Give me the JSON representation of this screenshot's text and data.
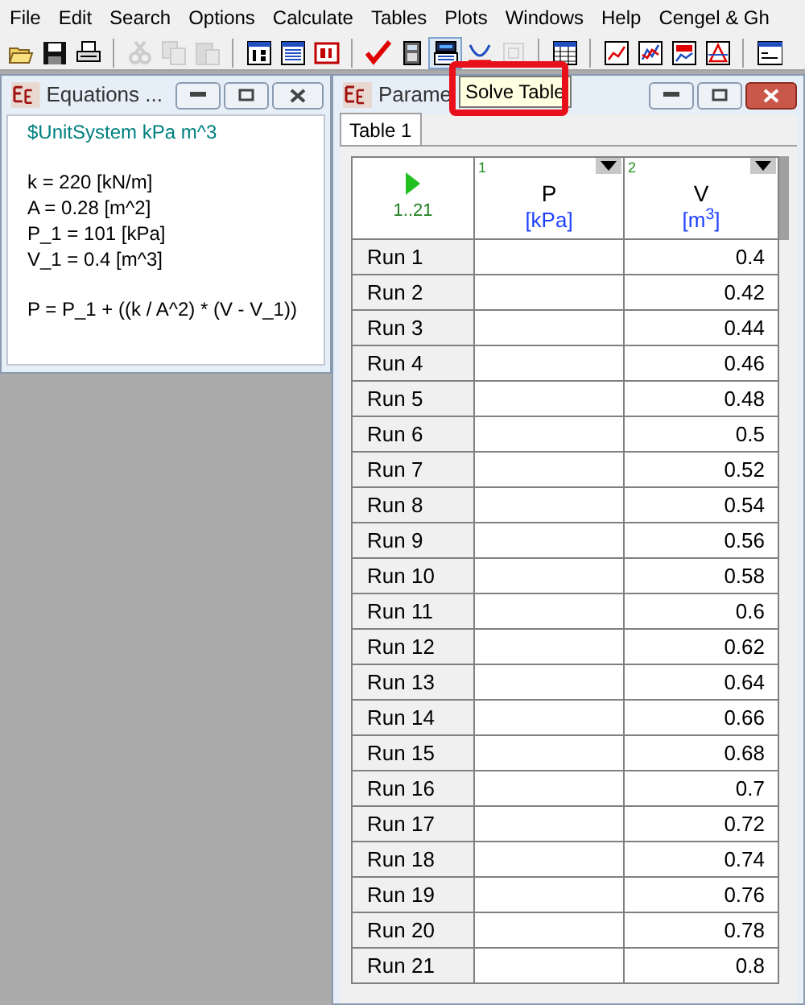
{
  "menu": [
    "File",
    "Edit",
    "Search",
    "Options",
    "Calculate",
    "Tables",
    "Plots",
    "Windows",
    "Help",
    "Cengel & Gh"
  ],
  "toolbar": [
    [
      {
        "kind": "open",
        "disabled": false
      },
      {
        "kind": "save",
        "disabled": false
      },
      {
        "kind": "print",
        "disabled": false
      }
    ],
    [
      {
        "kind": "cut",
        "disabled": true
      },
      {
        "kind": "copy",
        "disabled": true
      },
      {
        "kind": "paste",
        "disabled": true
      }
    ],
    [
      {
        "kind": "info",
        "disabled": false
      },
      {
        "kind": "list",
        "disabled": false
      },
      {
        "kind": "units",
        "disabled": false
      }
    ],
    [
      {
        "kind": "check",
        "disabled": false
      },
      {
        "kind": "calc",
        "disabled": false
      },
      {
        "kind": "solvetable",
        "disabled": false,
        "highlighted": true
      },
      {
        "kind": "curve",
        "disabled": false
      },
      {
        "kind": "gbox",
        "disabled": true
      }
    ],
    [
      {
        "kind": "table",
        "disabled": false
      }
    ],
    [
      {
        "kind": "plot1",
        "disabled": false
      },
      {
        "kind": "plot2",
        "disabled": false
      },
      {
        "kind": "plot3",
        "disabled": false
      },
      {
        "kind": "plot4",
        "disabled": false
      }
    ],
    [
      {
        "kind": "formula",
        "disabled": false
      }
    ]
  ],
  "tooltip": "Solve Table",
  "equations_window": {
    "title": "Equations ...",
    "blocks": [
      [
        {
          "kind": "directive",
          "text": "$UnitSystem kPa m^3"
        }
      ],
      [
        {
          "kind": "equation",
          "text": "k = 220 [kN/m]"
        },
        {
          "kind": "equation",
          "text": "A = 0.28 [m^2]"
        },
        {
          "kind": "equation",
          "text": "P_1 = 101 [kPa]"
        },
        {
          "kind": "equation",
          "text": "V_1 = 0.4 [m^3]"
        }
      ],
      [
        {
          "kind": "equation",
          "text": "P = P_1 + ((k / A^2) * (V - V_1))"
        }
      ]
    ]
  },
  "parametric_window": {
    "title": "Parame",
    "tabs": [
      {
        "label": "Table 1",
        "selected": true
      }
    ],
    "run_range": "1..21",
    "columns": [
      {
        "number": "1",
        "name": "P",
        "unit": "[kPa]"
      },
      {
        "number": "2",
        "name": "V",
        "unit": "[m$^{3}$]"
      }
    ],
    "rows": [
      {
        "label": "Run 1",
        "P": "",
        "V": "0.4"
      },
      {
        "label": "Run 2",
        "P": "",
        "V": "0.42"
      },
      {
        "label": "Run 3",
        "P": "",
        "V": "0.44"
      },
      {
        "label": "Run 4",
        "P": "",
        "V": "0.46"
      },
      {
        "label": "Run 5",
        "P": "",
        "V": "0.48"
      },
      {
        "label": "Run 6",
        "P": "",
        "V": "0.5"
      },
      {
        "label": "Run 7",
        "P": "",
        "V": "0.52"
      },
      {
        "label": "Run 8",
        "P": "",
        "V": "0.54"
      },
      {
        "label": "Run 9",
        "P": "",
        "V": "0.56"
      },
      {
        "label": "Run 10",
        "P": "",
        "V": "0.58"
      },
      {
        "label": "Run 11",
        "P": "",
        "V": "0.6"
      },
      {
        "label": "Run 12",
        "P": "",
        "V": "0.62"
      },
      {
        "label": "Run 13",
        "P": "",
        "V": "0.64"
      },
      {
        "label": "Run 14",
        "P": "",
        "V": "0.66"
      },
      {
        "label": "Run 15",
        "P": "",
        "V": "0.68"
      },
      {
        "label": "Run 16",
        "P": "",
        "V": "0.7"
      },
      {
        "label": "Run 17",
        "P": "",
        "V": "0.72"
      },
      {
        "label": "Run 18",
        "P": "",
        "V": "0.74"
      },
      {
        "label": "Run 19",
        "P": "",
        "V": "0.76"
      },
      {
        "label": "Run 20",
        "P": "",
        "V": "0.78"
      },
      {
        "label": "Run 21",
        "P": "",
        "V": "0.8"
      }
    ]
  }
}
